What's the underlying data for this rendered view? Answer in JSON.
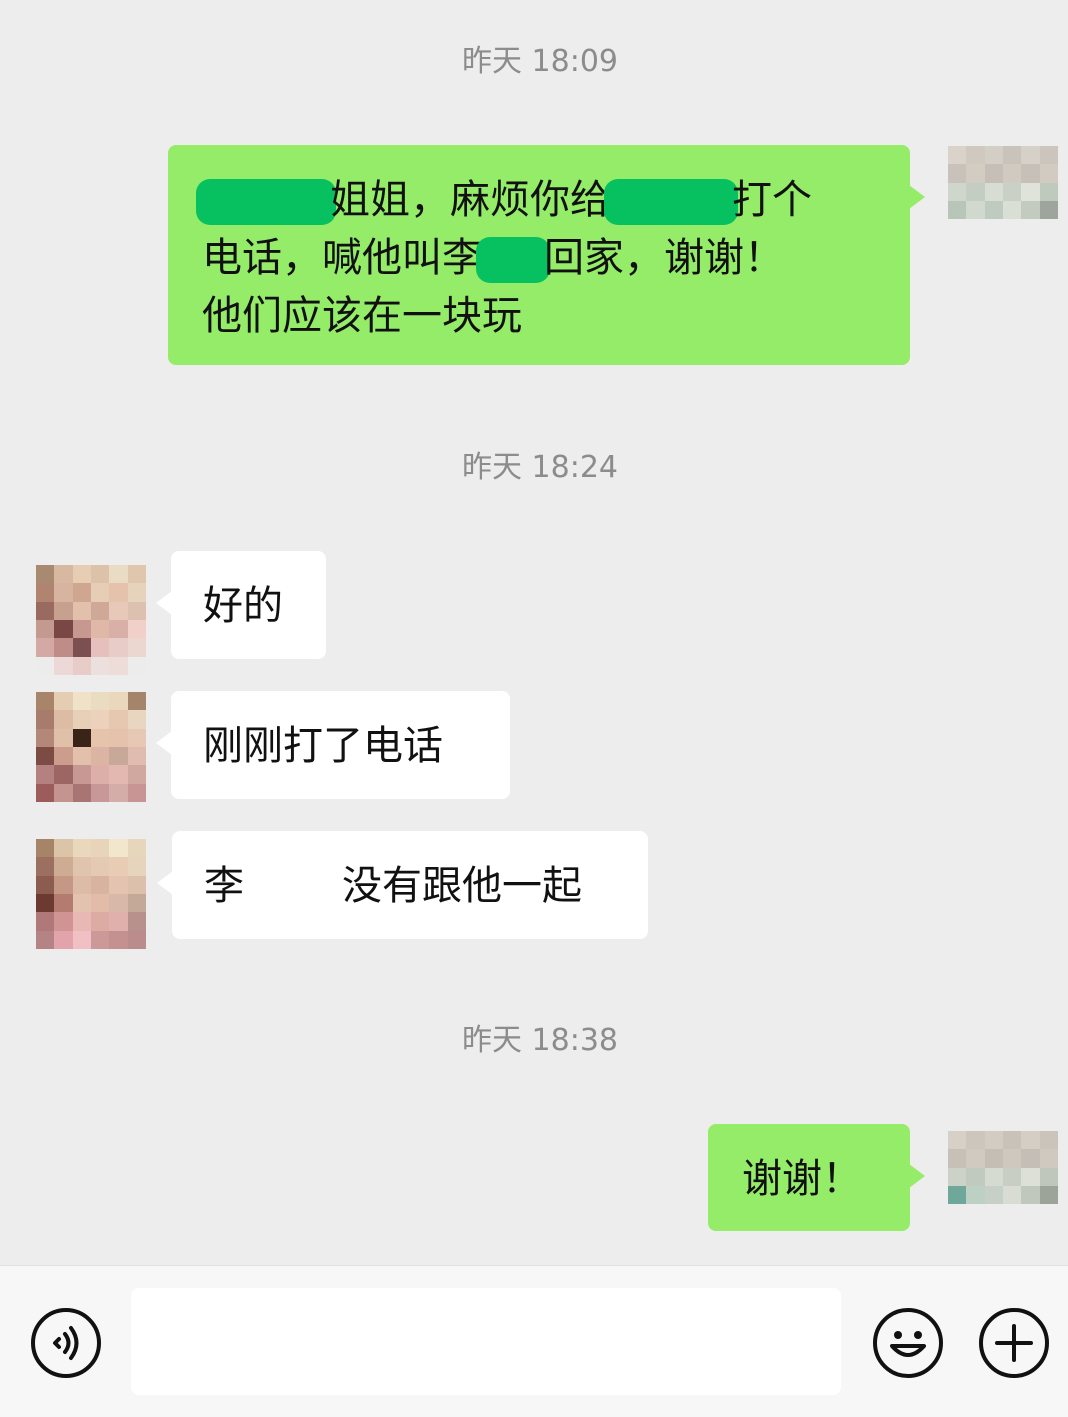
{
  "colors": {
    "background": "#ededed",
    "outgoing_bubble": "#95ec69",
    "incoming_bubble": "#ffffff",
    "timestamp": "#8c8c8c",
    "redaction": "#07c160"
  },
  "timestamps": [
    "昨天 18:09",
    "昨天 18:24",
    "昨天 18:38"
  ],
  "messages": [
    {
      "sender": "me",
      "segments": [
        "姐姐，麻烦你给",
        "打个",
        "电话，喊他叫李",
        "回家，谢谢！",
        "他们应该在一块玩"
      ]
    },
    {
      "sender": "contact",
      "text": "好的"
    },
    {
      "sender": "contact",
      "text": "刚刚打了电话"
    },
    {
      "sender": "contact",
      "segments": [
        "李",
        "没有跟他一起"
      ]
    },
    {
      "sender": "me",
      "text": "谢谢！"
    }
  ],
  "input_bar": {
    "voice_icon": "voice-icon",
    "emoji_icon": "emoji-icon",
    "plus_icon": "plus-icon"
  }
}
